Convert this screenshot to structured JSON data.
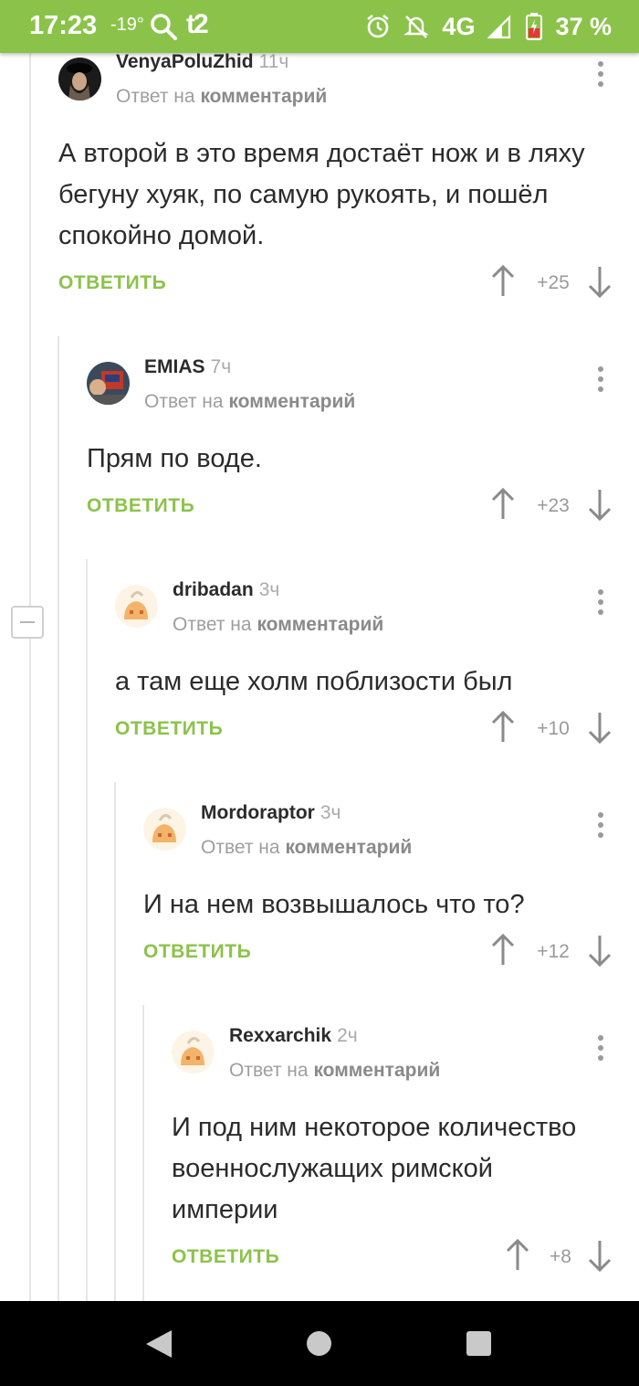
{
  "status_bar": {
    "time": "17:23",
    "temperature": "-19°",
    "carrier": "t2",
    "network": "4G",
    "battery": "37 %"
  },
  "comments": [
    {
      "author": "VenyaPoluZhid",
      "time": "11ч",
      "reply_prefix": "Ответ на",
      "reply_link": "комментарий",
      "text": "А второй в это время достаёт нож и в ляху бегуну хуяк, по самую рукоять, и пошёл спокойно домой.",
      "reply_label": "ОТВЕТИТЬ",
      "score": "+25"
    },
    {
      "author": "EMIAS",
      "time": "7ч",
      "reply_prefix": "Ответ на",
      "reply_link": "комментарий",
      "text": "Прям по воде.",
      "reply_label": "ОТВЕТИТЬ",
      "score": "+23"
    },
    {
      "author": "dribadan",
      "time": "3ч",
      "reply_prefix": "Ответ на",
      "reply_link": "комментарий",
      "text": "а там еще холм поблизости был",
      "reply_label": "ОТВЕТИТЬ",
      "score": "+10"
    },
    {
      "author": "Mordoraptor",
      "time": "3ч",
      "reply_prefix": "Ответ на",
      "reply_link": "комментарий",
      "text": "И на нем возвышалось что то?",
      "reply_label": "ОТВЕТИТЬ",
      "score": "+12"
    },
    {
      "author": "Rexxarchik",
      "time": "2ч",
      "reply_prefix": "Ответ на",
      "reply_link": "комментарий",
      "text": "И под ним некоторое количество военнослужащих римской империи",
      "reply_label": "ОТВЕТИТЬ",
      "score": "+8"
    }
  ],
  "colors": {
    "accent": "#8bc34a",
    "muted": "#9e9e9e",
    "text": "#2b2b2b"
  }
}
